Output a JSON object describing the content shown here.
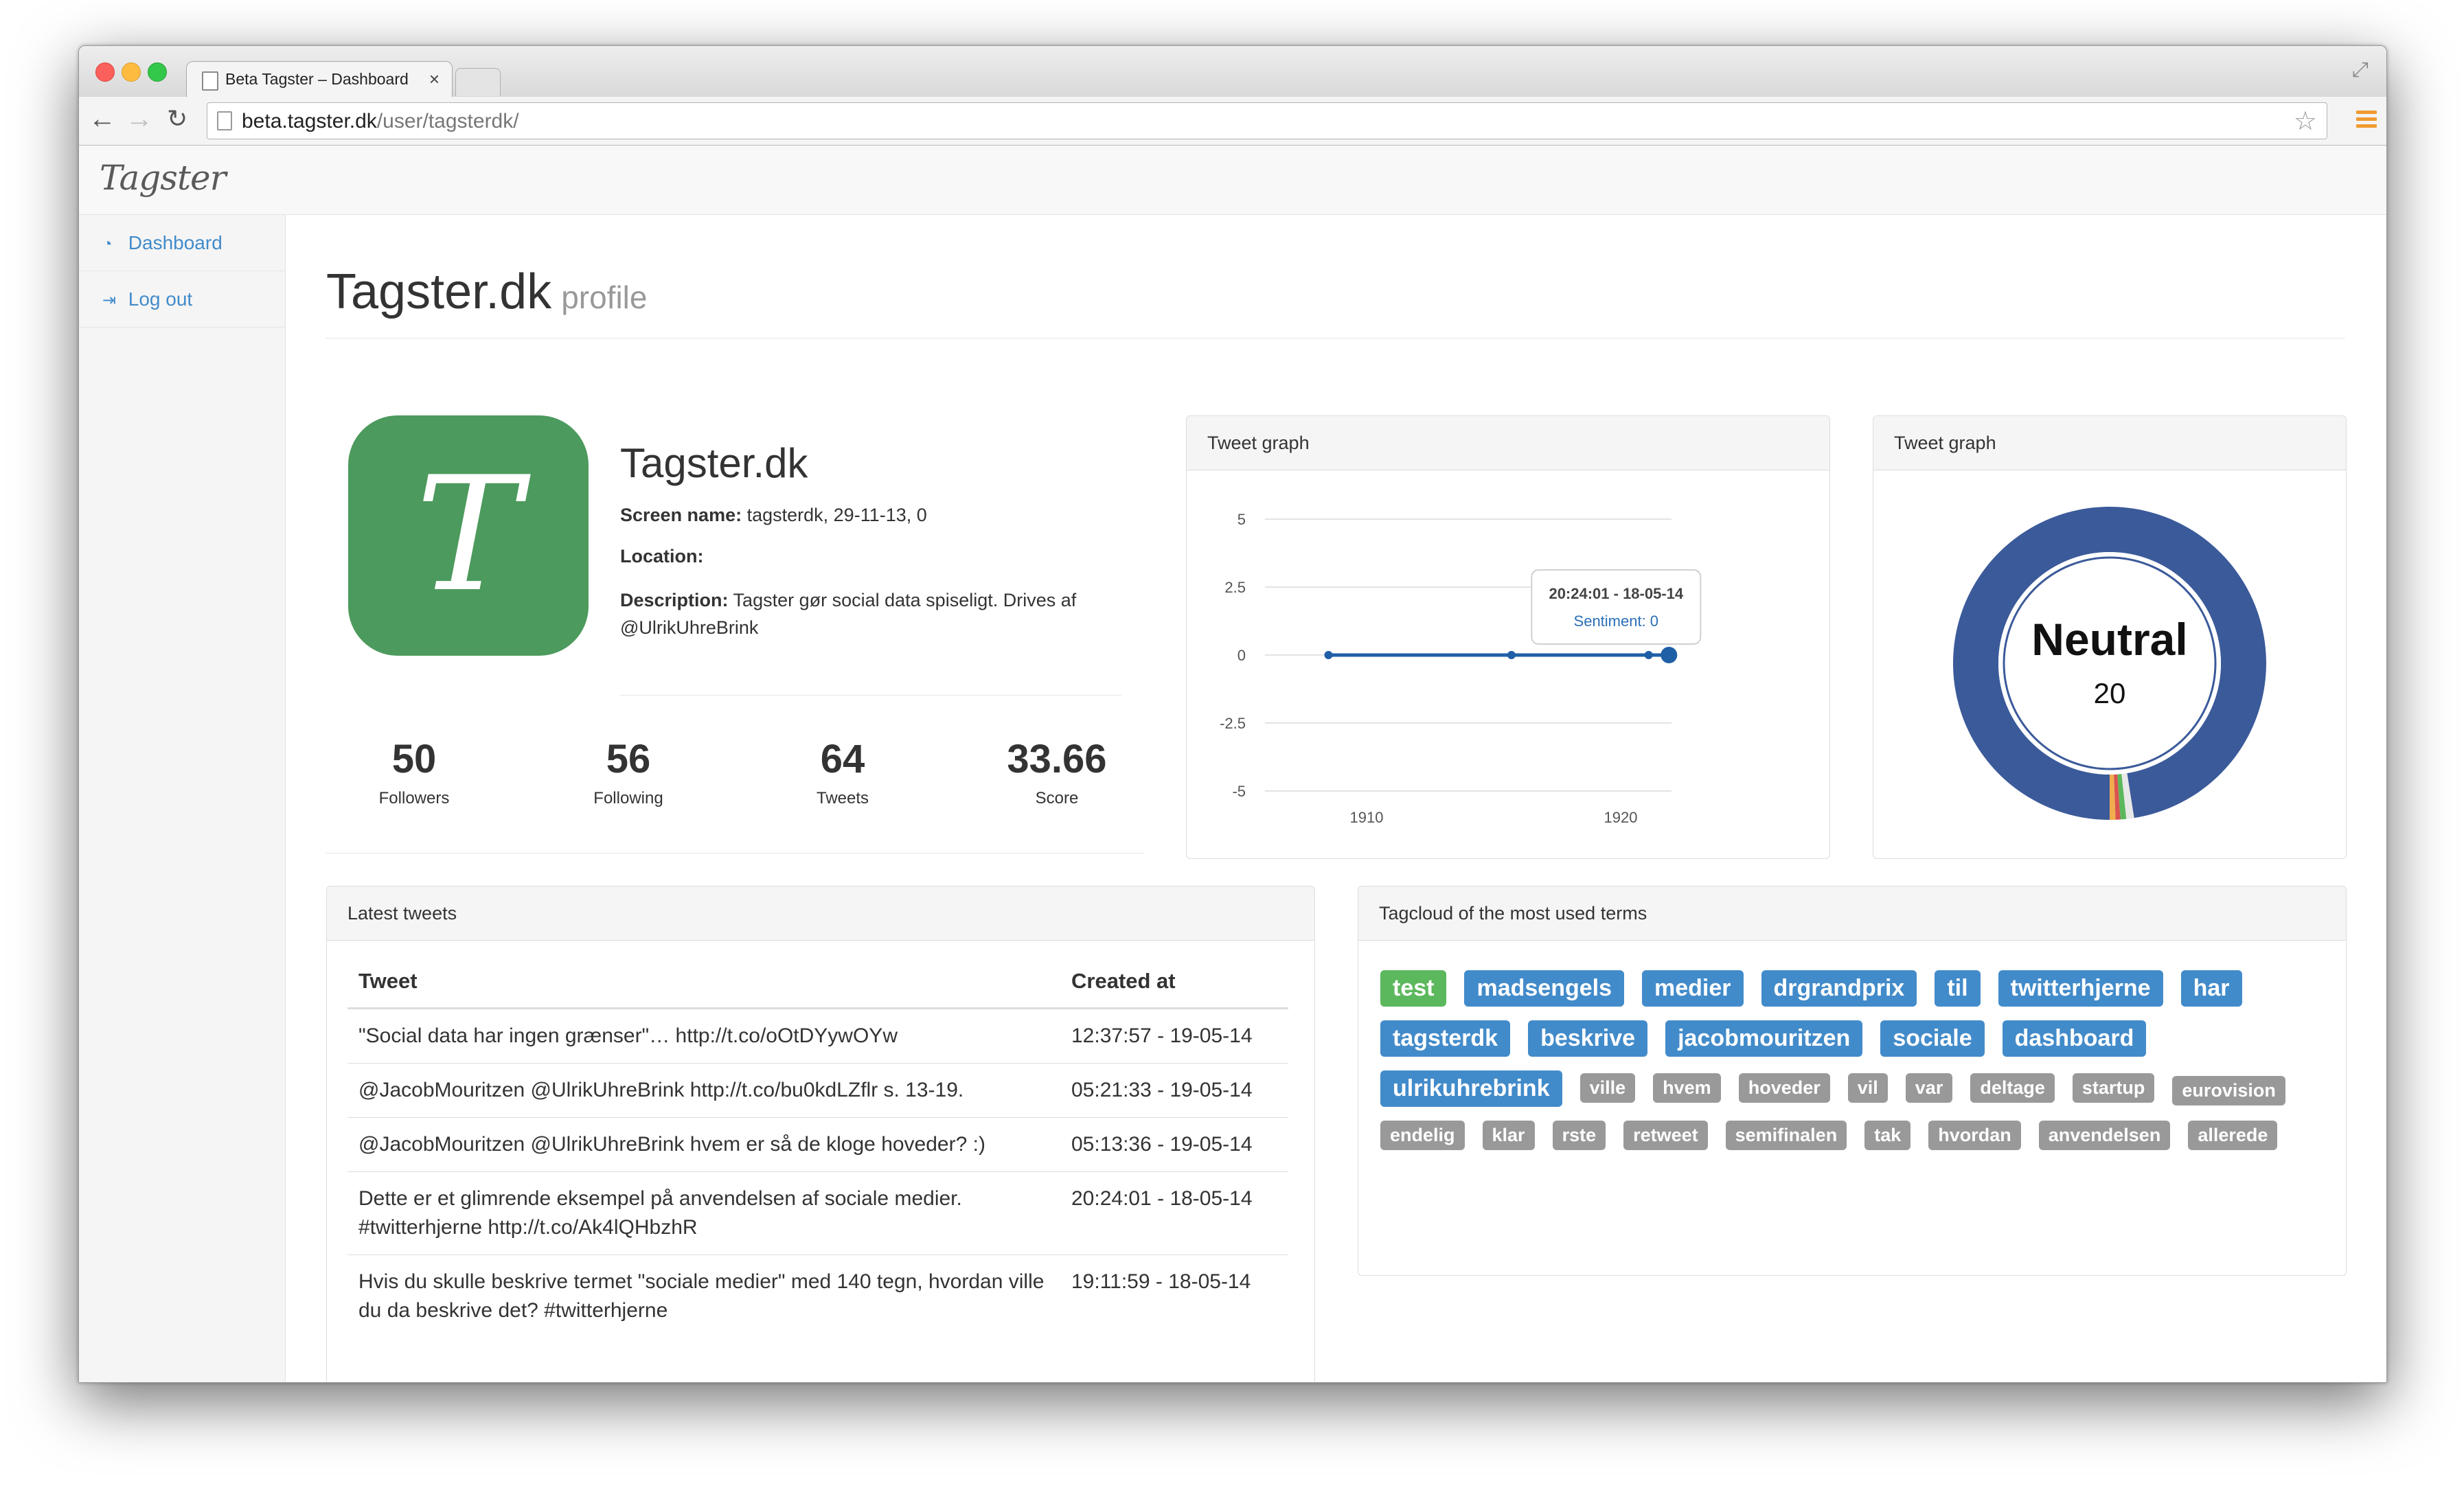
{
  "browser": {
    "tab_title": "Beta Tagster – Dashboard",
    "url_host": "beta.tagster.dk",
    "url_path": "/user/tagsterdk/"
  },
  "navbar": {
    "brand": "Tagster"
  },
  "sidebar": {
    "items": [
      {
        "label": "Dashboard",
        "icon": "dashboard-icon"
      },
      {
        "label": "Log out",
        "icon": "logout-icon"
      }
    ]
  },
  "header": {
    "title": "Tagster.dk",
    "subtitle": "profile"
  },
  "profile": {
    "avatar_letter": "T",
    "avatar_color": "#4c9a5d",
    "name": "Tagster.dk",
    "screen_name_label": "Screen name:",
    "screen_name_value": "tagsterdk, 29-11-13, 0",
    "location_label": "Location:",
    "location_value": "",
    "description_label": "Description:",
    "description_value": "Tagster gør social data spiseligt. Drives af @UlrikUhreBrink"
  },
  "stats": [
    {
      "value": "50",
      "label": "Followers"
    },
    {
      "value": "56",
      "label": "Following"
    },
    {
      "value": "64",
      "label": "Tweets"
    },
    {
      "value": "33.66",
      "label": "Score"
    }
  ],
  "line_panel": {
    "title": "Tweet graph"
  },
  "donut_panel": {
    "title": "Tweet graph"
  },
  "chart_data": [
    {
      "type": "line",
      "title": "",
      "xlabel": "",
      "ylabel": "",
      "x": [
        1908.5,
        1915.7,
        1921.1,
        1921.9
      ],
      "y": [
        0,
        0,
        0,
        0
      ],
      "xlim": [
        1906,
        1922
      ],
      "ylim": [
        -5,
        5
      ],
      "x_ticks": [
        "1910",
        "1920"
      ],
      "y_ticks": [
        "5",
        "2.5",
        "0",
        "-2.5",
        "-5"
      ],
      "tooltip": {
        "title": "20:24:01 - 18-05-14",
        "text": "Sentiment: 0"
      },
      "color": "#1f5fa6",
      "grid": true
    },
    {
      "type": "pie",
      "title": "",
      "center_label": "Neutral",
      "center_value": "20",
      "slices": [
        {
          "value": 0.975,
          "color": "#3b5a9a"
        },
        {
          "value": 0.008,
          "color": "#e8e8e8"
        },
        {
          "value": 0.006,
          "color": "#5cb85c"
        },
        {
          "value": 0.005,
          "color": "#d9534f"
        },
        {
          "value": 0.006,
          "color": "#f0ad4e"
        }
      ]
    }
  ],
  "tweets": {
    "title": "Latest tweets",
    "columns": [
      "Tweet",
      "Created at"
    ],
    "rows": [
      {
        "tweet": "\"Social data har ingen grænser\"… http://t.co/oOtDYywOYw",
        "created": "12:37:57 - 19-05-14"
      },
      {
        "tweet": "@JacobMouritzen @UlrikUhreBrink http://t.co/bu0kdLZflr s. 13-19.",
        "created": "05:21:33 - 19-05-14"
      },
      {
        "tweet": "@JacobMouritzen @UlrikUhreBrink hvem er så de kloge hoveder? :)",
        "created": "05:13:36 - 19-05-14"
      },
      {
        "tweet": "Dette er et glimrende eksempel på anvendelsen af sociale medier. #twitterhjerne http://t.co/Ak4lQHbzhR",
        "created": "20:24:01 - 18-05-14"
      },
      {
        "tweet": "Hvis du skulle beskrive termet \"sociale medier\" med 140 tegn, hvordan ville du da beskrive det? #twitterhjerne",
        "created": "19:11:59 - 18-05-14"
      }
    ]
  },
  "tagcloud": {
    "title": "Tagcloud of the most used terms",
    "tags": [
      {
        "text": "test",
        "style": "success",
        "size": "l"
      },
      {
        "text": "madsengels",
        "style": "primary",
        "size": "l"
      },
      {
        "text": "medier",
        "style": "primary",
        "size": "l"
      },
      {
        "text": "drgrandprix",
        "style": "primary",
        "size": "l"
      },
      {
        "text": "til",
        "style": "primary",
        "size": "l"
      },
      {
        "text": "twitterhjerne",
        "style": "primary",
        "size": "l"
      },
      {
        "text": "har",
        "style": "primary",
        "size": "l"
      },
      {
        "text": "tagsterdk",
        "style": "primary",
        "size": "l"
      },
      {
        "text": "beskrive",
        "style": "primary",
        "size": "l"
      },
      {
        "text": "jacobmouritzen",
        "style": "primary",
        "size": "l"
      },
      {
        "text": "sociale",
        "style": "primary",
        "size": "l"
      },
      {
        "text": "dashboard",
        "style": "primary",
        "size": "l"
      },
      {
        "text": "ulrikuhrebrink",
        "style": "primary",
        "size": "l"
      },
      {
        "text": "ville",
        "style": "default",
        "size": "s"
      },
      {
        "text": "hvem",
        "style": "default",
        "size": "s"
      },
      {
        "text": "hoveder",
        "style": "default",
        "size": "s"
      },
      {
        "text": "vil",
        "style": "default",
        "size": "s"
      },
      {
        "text": "var",
        "style": "default",
        "size": "s"
      },
      {
        "text": "deltage",
        "style": "default",
        "size": "s"
      },
      {
        "text": "startup",
        "style": "default",
        "size": "s"
      },
      {
        "text": "eurovision",
        "style": "default",
        "size": "xs"
      },
      {
        "text": "endelig",
        "style": "default",
        "size": "xs"
      },
      {
        "text": "klar",
        "style": "default",
        "size": "xs"
      },
      {
        "text": "rste",
        "style": "default",
        "size": "xs"
      },
      {
        "text": "retweet",
        "style": "default",
        "size": "xs"
      },
      {
        "text": "semifinalen",
        "style": "default",
        "size": "xs"
      },
      {
        "text": "tak",
        "style": "default",
        "size": "xs"
      },
      {
        "text": "hvordan",
        "style": "default",
        "size": "xs"
      },
      {
        "text": "anvendelsen",
        "style": "default",
        "size": "xs"
      },
      {
        "text": "allerede",
        "style": "default",
        "size": "xs"
      }
    ]
  }
}
